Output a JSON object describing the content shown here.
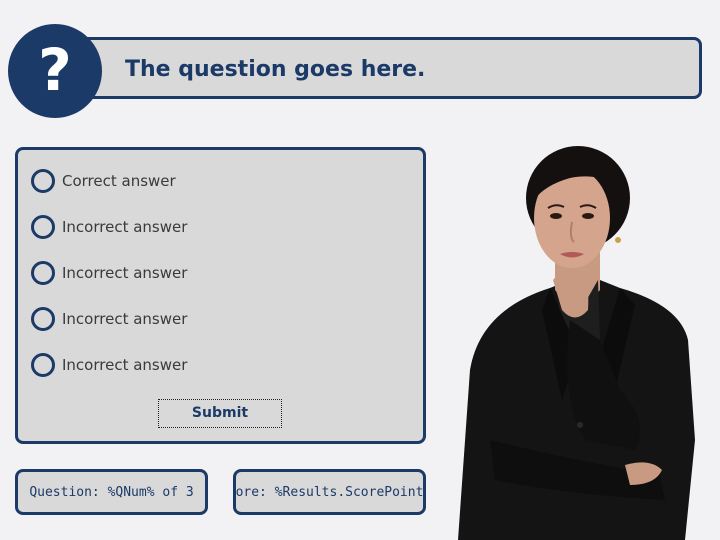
{
  "question": {
    "icon": "question-mark-icon",
    "icon_glyph": "?",
    "title": "The question goes here."
  },
  "answers": [
    {
      "label": "Correct answer",
      "selected": false
    },
    {
      "label": "Incorrect answer",
      "selected": false
    },
    {
      "label": "Incorrect answer",
      "selected": false
    },
    {
      "label": "Incorrect answer",
      "selected": false
    },
    {
      "label": "Incorrect answer",
      "selected": false
    }
  ],
  "submit_label": "Submit",
  "footer": {
    "question_counter": "Question: %QNum% of 3",
    "score": "Score: %Results.ScorePoints%"
  },
  "colors": {
    "accent": "#1b3a68",
    "panel": "#d9d9d9",
    "background": "#f2f2f4"
  }
}
